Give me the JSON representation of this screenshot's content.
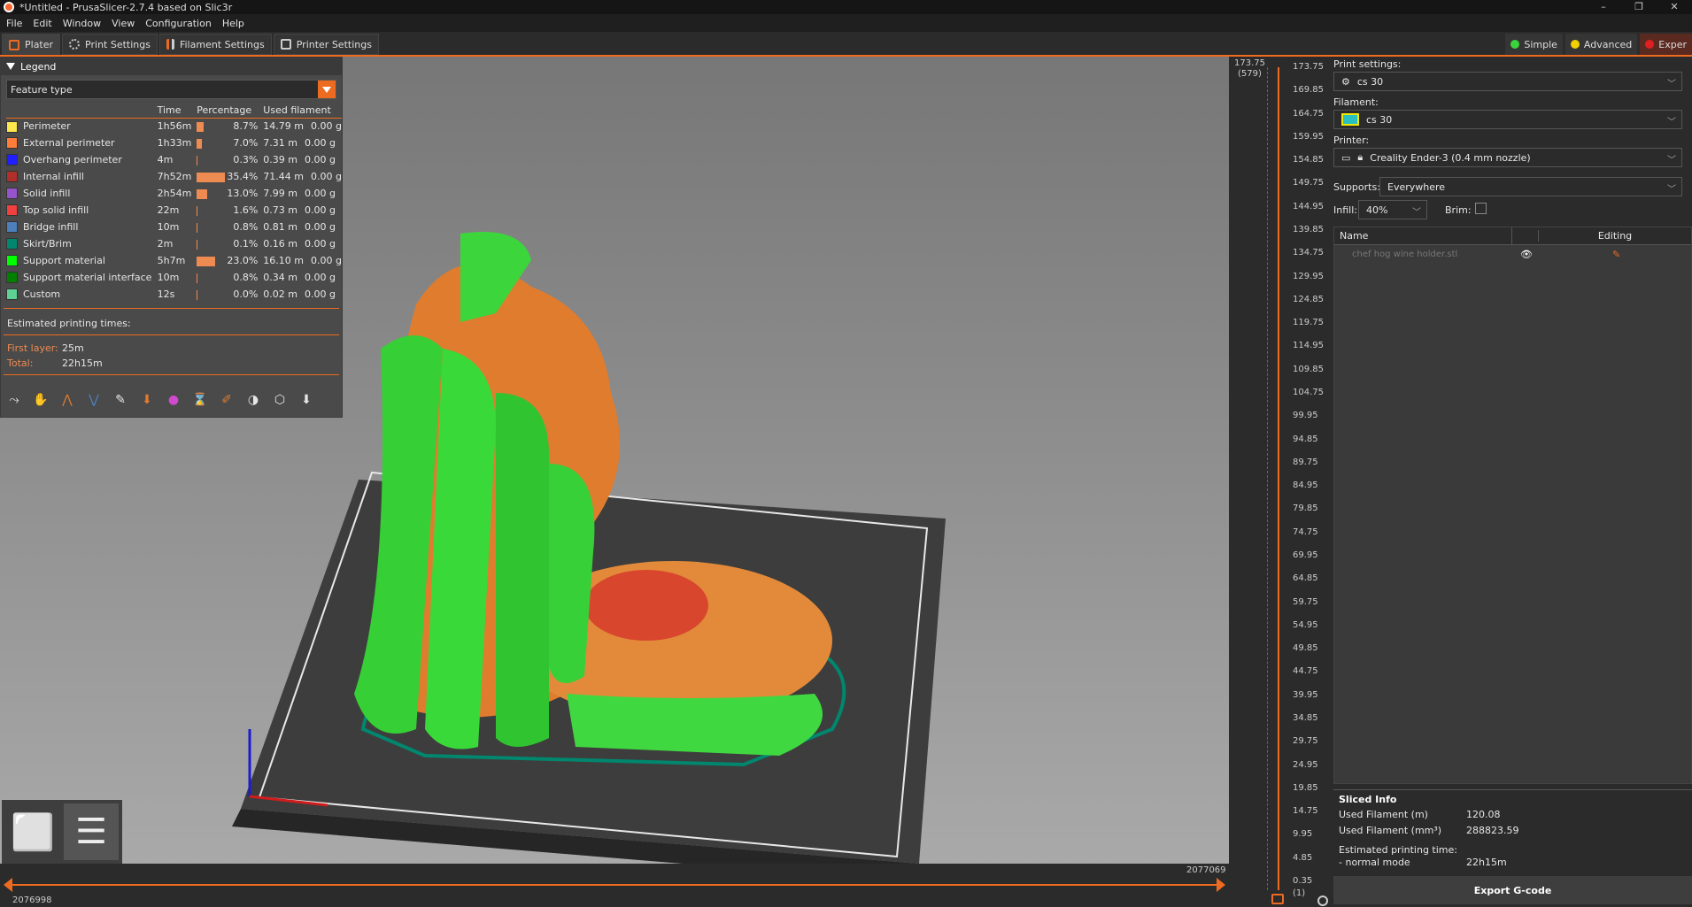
{
  "window": {
    "title": "*Untitled - PrusaSlicer-2.7.4 based on Slic3r"
  },
  "menu": [
    "File",
    "Edit",
    "Window",
    "View",
    "Configuration",
    "Help"
  ],
  "tabs": [
    {
      "label": "Plater"
    },
    {
      "label": "Print Settings"
    },
    {
      "label": "Filament Settings"
    },
    {
      "label": "Printer Settings"
    }
  ],
  "modes": [
    {
      "label": "Simple",
      "color": "#3bd33b"
    },
    {
      "label": "Advanced",
      "color": "#f0d000"
    },
    {
      "label": "Exper",
      "color": "#e02020"
    }
  ],
  "legend": {
    "title": "Legend",
    "view_type": "Feature type",
    "columns": [
      "Time",
      "Percentage",
      "Used filament"
    ],
    "rows": [
      {
        "name": "Perimeter",
        "color": "#ffe64d",
        "time": "1h56m",
        "pct": "8.7%",
        "bar": 0.087,
        "length": "14.79 m",
        "weight": "0.00 g"
      },
      {
        "name": "External perimeter",
        "color": "#ff7d38",
        "time": "1h33m",
        "pct": "7.0%",
        "bar": 0.07,
        "length": "7.31 m",
        "weight": "0.00 g"
      },
      {
        "name": "Overhang perimeter",
        "color": "#1f1fff",
        "time": "4m",
        "pct": "0.3%",
        "bar": 0.003,
        "length": "0.39 m",
        "weight": "0.00 g"
      },
      {
        "name": "Internal infill",
        "color": "#b03029",
        "time": "7h52m",
        "pct": "35.4%",
        "bar": 0.354,
        "length": "71.44 m",
        "weight": "0.00 g"
      },
      {
        "name": "Solid infill",
        "color": "#9654cc",
        "time": "2h54m",
        "pct": "13.0%",
        "bar": 0.13,
        "length": "7.99 m",
        "weight": "0.00 g"
      },
      {
        "name": "Top solid infill",
        "color": "#f04040",
        "time": "22m",
        "pct": "1.6%",
        "bar": 0.016,
        "length": "0.73 m",
        "weight": "0.00 g"
      },
      {
        "name": "Bridge infill",
        "color": "#4d80ba",
        "time": "10m",
        "pct": "0.8%",
        "bar": 0.008,
        "length": "0.81 m",
        "weight": "0.00 g"
      },
      {
        "name": "Skirt/Brim",
        "color": "#00876e",
        "time": "2m",
        "pct": "0.1%",
        "bar": 0.001,
        "length": "0.16 m",
        "weight": "0.00 g"
      },
      {
        "name": "Support material",
        "color": "#00ff00",
        "time": "5h7m",
        "pct": "23.0%",
        "bar": 0.23,
        "length": "16.10 m",
        "weight": "0.00 g"
      },
      {
        "name": "Support material interface",
        "color": "#008000",
        "time": "10m",
        "pct": "0.8%",
        "bar": 0.008,
        "length": "0.34 m",
        "weight": "0.00 g"
      },
      {
        "name": "Custom",
        "color": "#5ed194",
        "time": "12s",
        "pct": "0.0%",
        "bar": 0.0,
        "length": "0.02 m",
        "weight": "0.00 g"
      }
    ],
    "estimated_label": "Estimated printing times:",
    "first_layer_label": "First layer:",
    "first_layer": "25m",
    "total_label": "Total:",
    "total": "22h15m",
    "tool_icons": [
      "travel-icon",
      "wipe-icon",
      "retractions-icon",
      "deretractions-icon",
      "seams-icon",
      "tool-changes-icon",
      "color-changes-icon",
      "pause-icon",
      "custom-gcode-icon",
      "center-of-gravity-icon",
      "shells-icon",
      "tool-marker-icon"
    ]
  },
  "hslider": {
    "left_value": "2076998",
    "right_value": "2077069"
  },
  "vslider": {
    "top_value": "173.75",
    "top_layer": "(579)",
    "bottom_value": "0.35",
    "bottom_layer": "(1)",
    "ticks": [
      "173.75",
      "169.85",
      "164.75",
      "159.95",
      "154.85",
      "149.75",
      "144.95",
      "139.85",
      "134.75",
      "129.95",
      "124.85",
      "119.75",
      "114.95",
      "109.85",
      "104.75",
      "99.95",
      "94.85",
      "89.75",
      "84.95",
      "79.85",
      "74.75",
      "69.95",
      "64.85",
      "59.75",
      "54.95",
      "49.85",
      "44.75",
      "39.95",
      "34.85",
      "29.75",
      "24.95",
      "19.85",
      "14.75",
      "9.95",
      "4.85",
      "0.35"
    ]
  },
  "right_panel": {
    "print_settings_label": "Print settings:",
    "print_settings": "cs 30",
    "filament_label": "Filament:",
    "filament": "cs 30",
    "printer_label": "Printer:",
    "printer": "Creality Ender-3 (0.4 mm nozzle)",
    "supports_label": "Supports:",
    "supports": "Everywhere",
    "infill_label": "Infill:",
    "infill": "40%",
    "brim_label": "Brim:",
    "list_name_header": "Name",
    "list_editing_header": "Editing",
    "object_name": "chef hog wine holder.stl",
    "sliced_info_title": "Sliced Info",
    "used_filament_m_label": "Used Filament (m)",
    "used_filament_m": "120.08",
    "used_filament_mm3_label": "Used Filament (mm³)",
    "used_filament_mm3": "288823.59",
    "est_time_label": "Estimated printing time:",
    "normal_mode_label": "- normal mode",
    "normal_mode": "22h15m",
    "export_label": "Export G-code"
  }
}
